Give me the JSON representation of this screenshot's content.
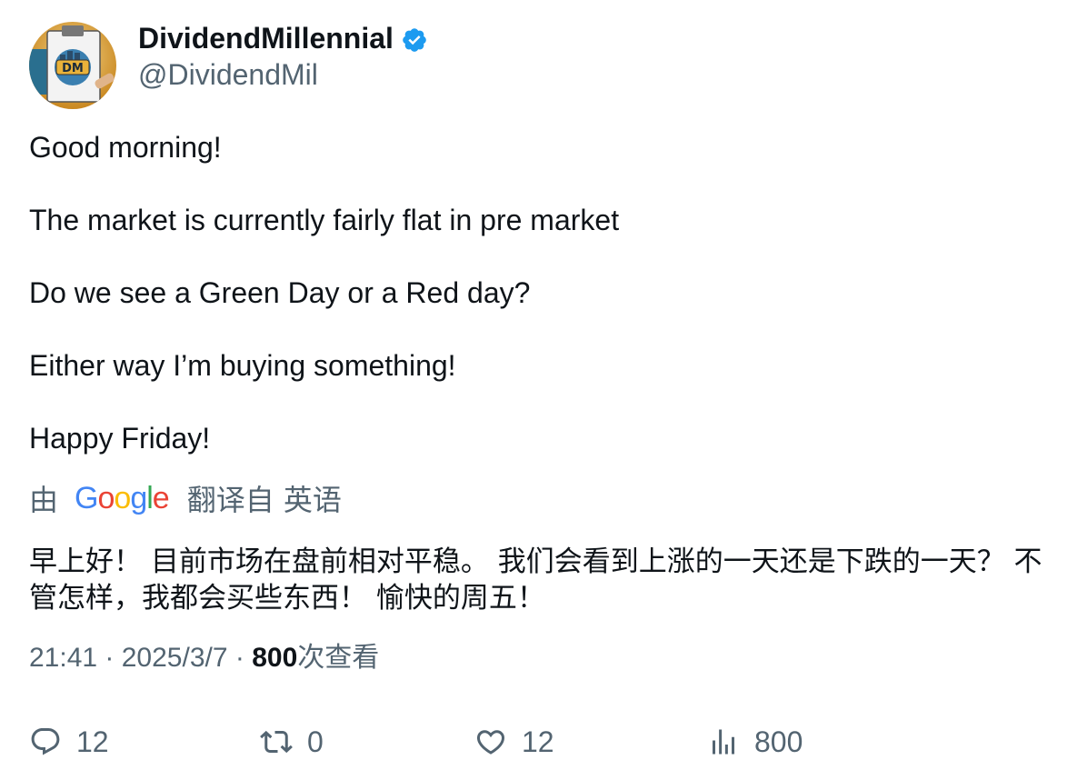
{
  "author": {
    "display_name": "DividendMillennial",
    "handle": "@DividendMil",
    "verified": true,
    "avatar_label": "DM",
    "verified_color": "#1d9bf0"
  },
  "tweet": {
    "paragraphs": [
      "Good morning!",
      "The market is currently fairly flat in pre market",
      "Do we see a Green Day or a Red day?",
      "Either way I’m buying something!",
      "Happy Friday!"
    ],
    "translation": {
      "by_label": "由",
      "provider": "Google",
      "from_label": "翻译自 英语",
      "text": "早上好！ 目前市场在盘前相对平稳。 我们会看到上涨的一天还是下跌的一天？ 不管怎样，我都会买些东西！ 愉快的周五！"
    }
  },
  "meta": {
    "time": "21:41",
    "separator": " · ",
    "date": "2025/3/7",
    "views_count": "800",
    "views_label": "次查看"
  },
  "actions": {
    "reply": {
      "icon": "reply-icon",
      "count": "12"
    },
    "retweet": {
      "icon": "retweet-icon",
      "count": "0"
    },
    "like": {
      "icon": "heart-icon",
      "count": "12"
    },
    "views": {
      "icon": "analytics-icon",
      "count": "800"
    }
  }
}
